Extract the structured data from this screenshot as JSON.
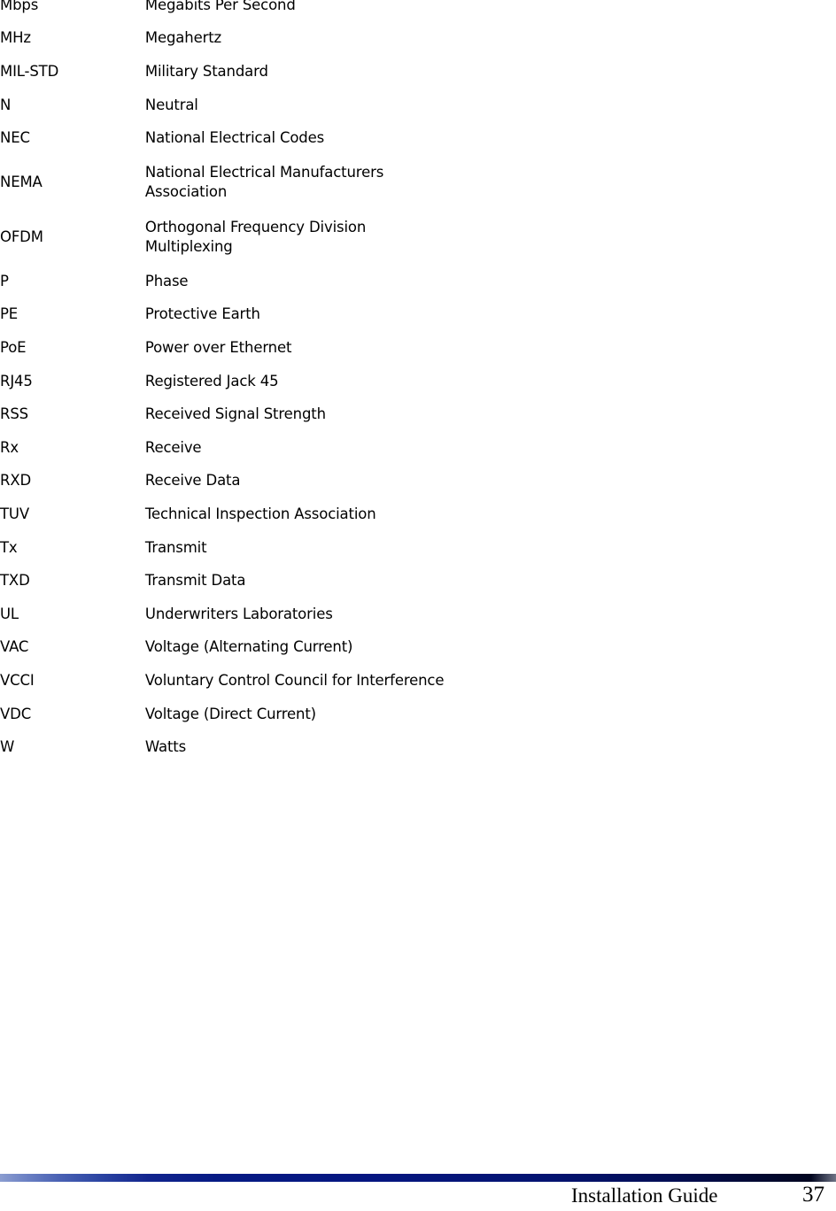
{
  "glossary": {
    "rows": [
      {
        "abbr": "Mbps",
        "description": [
          "Megabits Per Second"
        ]
      },
      {
        "abbr": "MHz",
        "description": [
          "Megahertz"
        ]
      },
      {
        "abbr": "MIL-STD",
        "description": [
          "Military Standard"
        ]
      },
      {
        "abbr": "N",
        "description": [
          "Neutral"
        ]
      },
      {
        "abbr": "NEC",
        "description": [
          "National Electrical Codes"
        ]
      },
      {
        "abbr": "NEMA",
        "description": [
          "National Electrical Manufacturers",
          "Association"
        ]
      },
      {
        "abbr": "OFDM",
        "description": [
          "Orthogonal Frequency Division",
          "Multiplexing"
        ]
      },
      {
        "abbr": "P",
        "description": [
          "Phase"
        ]
      },
      {
        "abbr": "PE",
        "description": [
          "Protective Earth"
        ]
      },
      {
        "abbr": "PoE",
        "description": [
          "Power over Ethernet"
        ]
      },
      {
        "abbr": "RJ45",
        "description": [
          "Registered Jack 45"
        ]
      },
      {
        "abbr": "RSS",
        "description": [
          "Received Signal Strength"
        ]
      },
      {
        "abbr": "Rx",
        "description": [
          "Receive"
        ]
      },
      {
        "abbr": "RXD",
        "description": [
          "Receive Data"
        ]
      },
      {
        "abbr": "TUV",
        "description": [
          "Technical Inspection Association"
        ]
      },
      {
        "abbr": "Tx",
        "description": [
          "Transmit"
        ]
      },
      {
        "abbr": "TXD",
        "description": [
          "Transmit Data"
        ]
      },
      {
        "abbr": "UL",
        "description": [
          "Underwriters Laboratories"
        ]
      },
      {
        "abbr": "VAC",
        "description": [
          "Voltage (Alternating Current)"
        ]
      },
      {
        "abbr": "VCCI",
        "description": [
          "Voluntary Control Council for Interference"
        ]
      },
      {
        "abbr": "VDC",
        "description": [
          "Voltage (Direct Current)"
        ]
      },
      {
        "abbr": "W",
        "description": [
          "Watts"
        ]
      }
    ]
  },
  "footer": {
    "title": "Installation Guide",
    "page_number": "37",
    "rule_color_start": "#8b9dd0",
    "rule_color_mid": "#041680",
    "rule_color_end": "#01061f"
  }
}
